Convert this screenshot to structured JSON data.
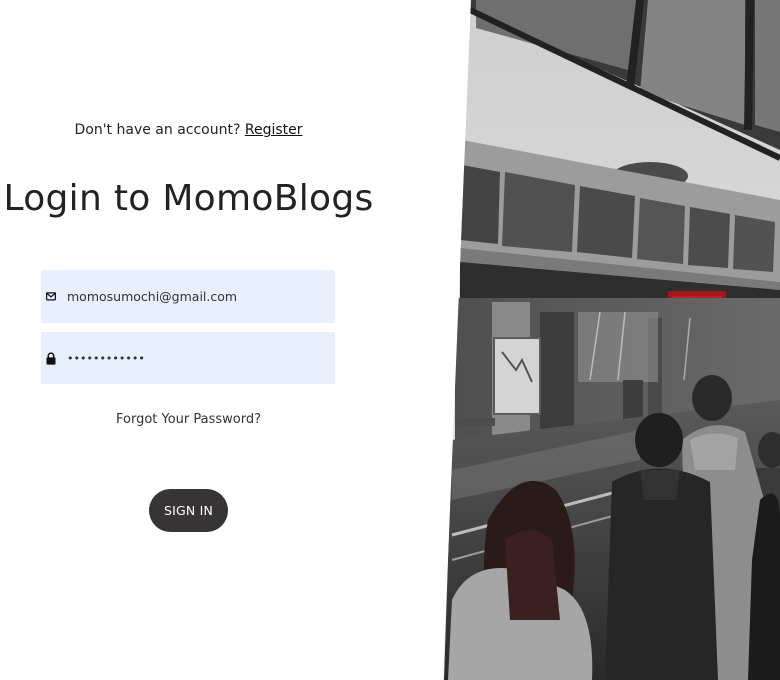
{
  "header": {
    "prompt_text": "Don't have an account?",
    "register_link": "Register"
  },
  "title": "Login to MomoBlogs",
  "form": {
    "email": {
      "value": "momosumochi@gmail.com",
      "icon": "envelope-icon"
    },
    "password": {
      "value": "••••••••••••",
      "icon": "lock-icon"
    },
    "forgot_password": "Forgot Your Password?",
    "submit_label": "SIGN IN"
  },
  "colors": {
    "field_background": "#e8f0fe",
    "button_background": "#363434",
    "button_text": "#ffffff",
    "photo_accent_red": "#a4161a"
  }
}
